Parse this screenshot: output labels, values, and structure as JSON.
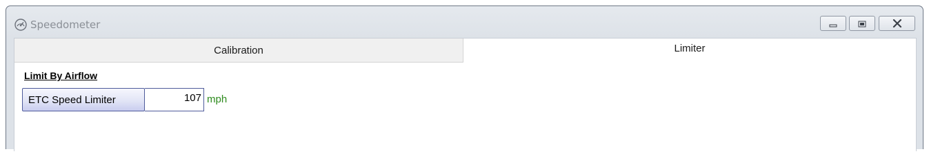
{
  "window": {
    "title": "Speedometer",
    "icon": "speedometer-icon",
    "controls": {
      "minimize_icon": "minimize-icon",
      "maximize_icon": "maximize-icon",
      "close_icon": "close-icon"
    }
  },
  "tabs": [
    {
      "label": "Calibration",
      "active": false
    },
    {
      "label": "Limiter",
      "active": true
    }
  ],
  "limiter": {
    "section_title": "Limit By Airflow",
    "fields": [
      {
        "label": "ETC Speed Limiter",
        "value": "107",
        "unit": "mph"
      }
    ]
  },
  "colors": {
    "unit_text": "#2e8b1e",
    "field_border": "#4d5a9a",
    "title_text": "#8a8f96"
  }
}
